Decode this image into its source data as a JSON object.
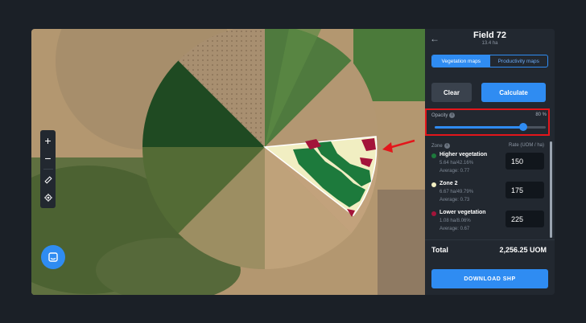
{
  "header": {
    "back_icon": "arrow-left-icon",
    "field_name": "Field 72",
    "field_area": "13.4 ha"
  },
  "tabs": [
    {
      "label": "Vegetation maps",
      "active": true
    },
    {
      "label": "Productivity maps",
      "active": false
    }
  ],
  "actions": {
    "clear_label": "Clear",
    "calculate_label": "Calculate"
  },
  "opacity": {
    "label": "Opacity",
    "value_text": "80 %",
    "value": 0.8
  },
  "zones_header": {
    "zone_label": "Zone",
    "rate_label": "Rate (UOM / ha)"
  },
  "zones": [
    {
      "name": "Higher vegetation",
      "area": "5.64 ha/42.16%",
      "average": "Average: 0.77",
      "rate": "150",
      "color": "#1d7a3c"
    },
    {
      "name": "Zone 2",
      "area": "6.67 ha/49.79%",
      "average": "Average: 0.73",
      "rate": "175",
      "color": "#f1eec2"
    },
    {
      "name": "Lower vegetation",
      "area": "1.08 ha/8.06%",
      "average": "Average: 0.67",
      "rate": "225",
      "color": "#a3143a"
    }
  ],
  "total": {
    "label": "Total",
    "value": "2,256.25 UOM"
  },
  "download_label": "DOWNLOAD SHP",
  "map_controls": {
    "zoom_in": "+",
    "zoom_out": "−",
    "icons": [
      "ruler-icon",
      "locate-icon"
    ]
  },
  "colors": {
    "accent": "#2f8cf2",
    "highlight": "#e3161b",
    "panel_bg": "#222830"
  }
}
